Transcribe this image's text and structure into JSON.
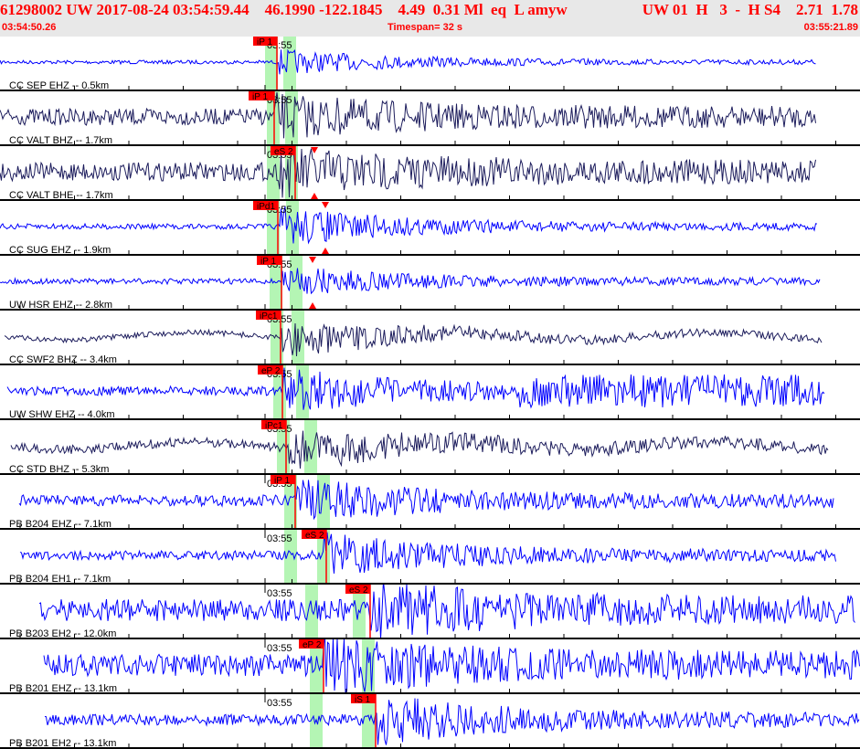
{
  "header": {
    "event_line_left": "61298002 UW 2017-08-24 03:54:59.44    46.1990 -122.1845    4.49  0.31 Ml  eq  L amyw",
    "event_line_right": "UW 01  H   3  -  H S4    2.71  1.78",
    "start_time": "03:54:50.26",
    "timespan": "Timespan=  32 s",
    "end_time": "03:55:21.89"
  },
  "minute_label": "03:55",
  "colors": {
    "accent": "#ff0000",
    "bg_header": "#e8e8e8",
    "trace_blue": "#0000ff",
    "trace_navy": "#1c1c5c",
    "window": "#b4f5b4"
  },
  "traces": [
    {
      "label": "CC SEP EHZ -- 0.5km",
      "color": "blue",
      "pick": "iP 1"
    },
    {
      "label": "CC VALT BHZ -- 1.7km",
      "color": "navy",
      "pick": "iP 1"
    },
    {
      "label": "CC VALT BHE -- 1.7km",
      "color": "navy",
      "pick": "eS 2"
    },
    {
      "label": "CC SUG EHZ -- 1.9km",
      "color": "blue",
      "pick": "iPd1"
    },
    {
      "label": "UW HSR EHZ -- 2.8km",
      "color": "blue",
      "pick": "iP 1"
    },
    {
      "label": "CC SWF2 BHZ -- 3.4km",
      "color": "navy",
      "pick": "iPc1"
    },
    {
      "label": "UW SHW EHZ -- 4.0km",
      "color": "blue",
      "pick": "eP 2"
    },
    {
      "label": "CC STD BHZ -- 5.3km",
      "color": "navy",
      "pick": "iPc1"
    },
    {
      "label": "PB B204 EHZ -- 7.1km",
      "color": "blue",
      "pick": "iP 1"
    },
    {
      "label": "PB B204 EH1 -- 7.1km",
      "color": "blue",
      "pick": "eS 2"
    },
    {
      "label": "PB B203 EH2 -- 12.0km",
      "color": "blue",
      "pick": "eS 2"
    },
    {
      "label": "PB B201 EHZ -- 13.1km",
      "color": "blue",
      "pick": "eP 2"
    },
    {
      "label": "PB B201 EH2 -- 13.1km",
      "color": "blue",
      "pick": "iS 1"
    }
  ]
}
